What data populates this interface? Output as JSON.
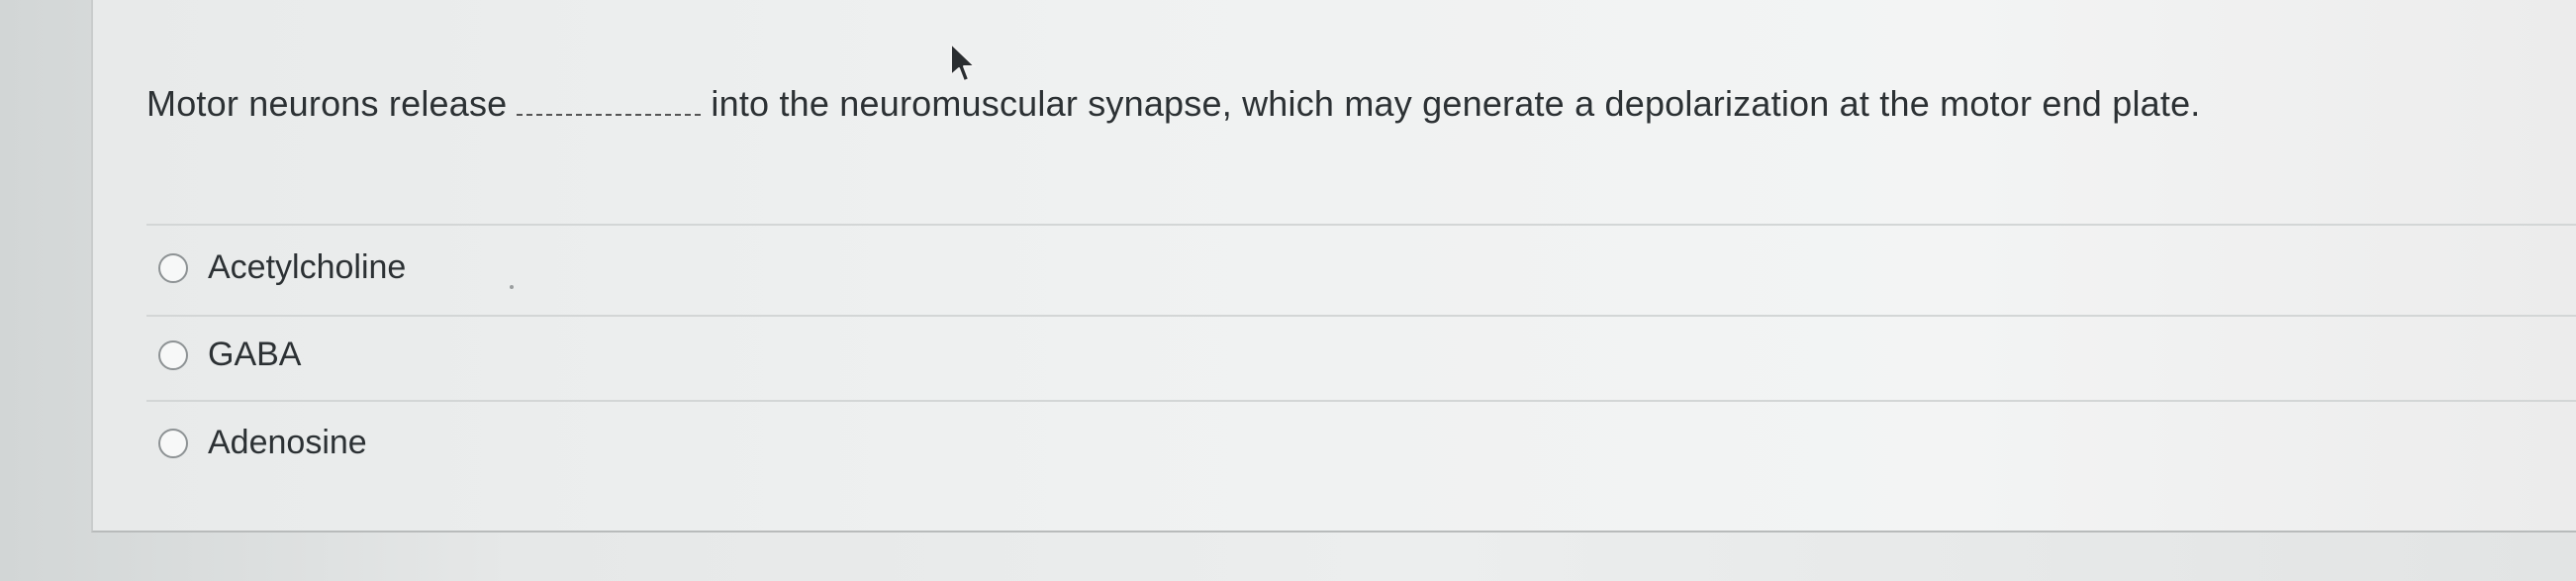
{
  "question": {
    "text_before": "Motor neurons release",
    "text_after": "into the neuromuscular synapse, which may generate a depolarization at the motor end plate."
  },
  "options": [
    {
      "label": "Acetylcholine",
      "selected": false
    },
    {
      "label": "GABA",
      "selected": false
    },
    {
      "label": "Adenosine",
      "selected": false
    }
  ],
  "colors": {
    "text": "#2c3134",
    "panel": "#eff1f1",
    "background": "#d9dcdc",
    "radio_border": "#8d9294"
  },
  "icons": [
    "mouse-cursor-icon",
    "radio-button-icon"
  ]
}
